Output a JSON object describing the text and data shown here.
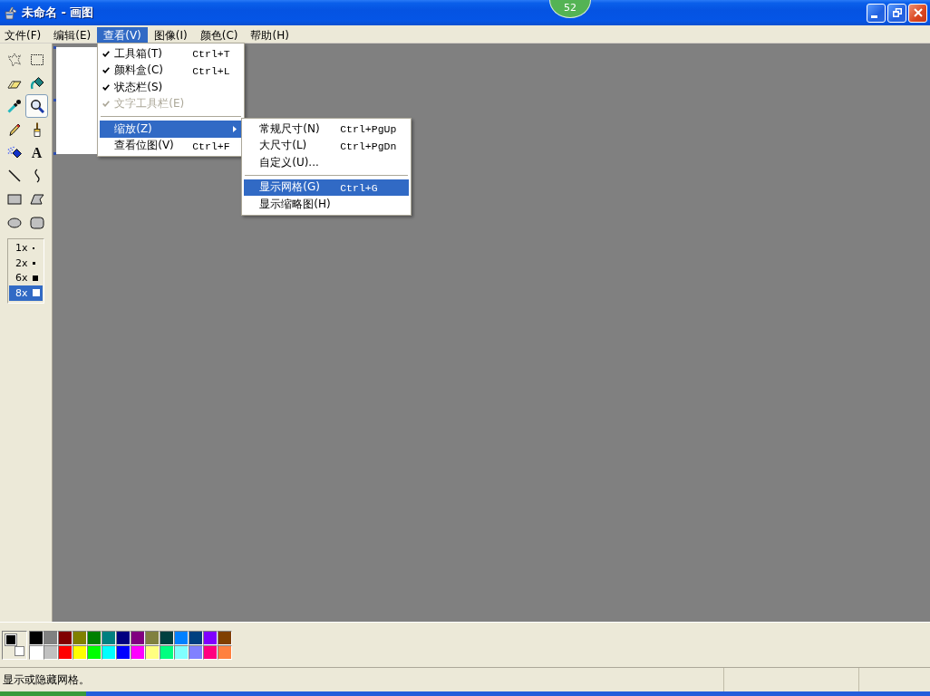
{
  "window": {
    "title": "未命名 - 画图"
  },
  "badge": {
    "text": "52"
  },
  "menu_bar": [
    {
      "label": "文件(F)",
      "selected": false
    },
    {
      "label": "编辑(E)",
      "selected": false
    },
    {
      "label": "查看(V)",
      "selected": true,
      "menu": {
        "groups": [
          [
            {
              "label": "工具箱(T)",
              "shortcut": "Ctrl+T",
              "checked": true,
              "disabled": false,
              "selected": false
            },
            {
              "label": "颜料盒(C)",
              "shortcut": "Ctrl+L",
              "checked": true,
              "disabled": false,
              "selected": false
            },
            {
              "label": "状态栏(S)",
              "checked": true,
              "disabled": false,
              "selected": false
            },
            {
              "label": "文字工具栏(E)",
              "checked": true,
              "disabled": true,
              "selected": false
            }
          ],
          [
            {
              "label": "缩放(Z)",
              "checked": false,
              "disabled": false,
              "selected": true,
              "submenu": {
                "groups": [
                  [
                    {
                      "label": "常规尺寸(N)",
                      "shortcut": "Ctrl+PgUp",
                      "selected": false
                    },
                    {
                      "label": "大尺寸(L)",
                      "shortcut": "Ctrl+PgDn",
                      "selected": false
                    },
                    {
                      "label": "自定义(U)...",
                      "selected": false
                    }
                  ],
                  [
                    {
                      "label": "显示网格(G)",
                      "shortcut": "Ctrl+G",
                      "selected": true
                    },
                    {
                      "label": "显示缩略图(H)",
                      "selected": false
                    }
                  ]
                ]
              }
            },
            {
              "label": "查看位图(V)",
              "shortcut": "Ctrl+F",
              "checked": false,
              "disabled": false,
              "selected": false
            }
          ]
        ]
      }
    },
    {
      "label": "图像(I)",
      "selected": false
    },
    {
      "label": "颜色(C)",
      "selected": false
    },
    {
      "label": "帮助(H)",
      "selected": false
    }
  ],
  "toolbox": {
    "tools": [
      {
        "kind": "free-form-select",
        "selected": false
      },
      {
        "kind": "select",
        "selected": false
      },
      {
        "kind": "eraser",
        "selected": false
      },
      {
        "kind": "fill",
        "selected": false
      },
      {
        "kind": "pick-color",
        "selected": false
      },
      {
        "kind": "magnifier",
        "selected": true
      },
      {
        "kind": "pencil",
        "selected": false
      },
      {
        "kind": "brush",
        "selected": false
      },
      {
        "kind": "airbrush",
        "selected": false
      },
      {
        "kind": "text",
        "glyph": "A",
        "selected": false
      },
      {
        "kind": "line",
        "selected": false
      },
      {
        "kind": "curve",
        "selected": false
      },
      {
        "kind": "rectangle",
        "selected": false
      },
      {
        "kind": "polygon",
        "selected": false
      },
      {
        "kind": "ellipse",
        "selected": false
      },
      {
        "kind": "rounded-rectangle",
        "selected": false
      }
    ],
    "zoom_options": [
      {
        "label": "1x",
        "selected": false
      },
      {
        "label": "2x",
        "selected": false
      },
      {
        "label": "6x",
        "selected": false
      },
      {
        "label": "8x",
        "selected": true
      }
    ]
  },
  "palette": {
    "current_colors": [
      {
        "kind": "foreground",
        "color": "#000000"
      },
      {
        "kind": "background",
        "color": "#ffffff"
      }
    ],
    "colors": [
      {
        "color": "#000000"
      },
      {
        "color": "#808080"
      },
      {
        "color": "#800000"
      },
      {
        "color": "#808000"
      },
      {
        "color": "#008000"
      },
      {
        "color": "#008080"
      },
      {
        "color": "#000080"
      },
      {
        "color": "#800080"
      },
      {
        "color": "#808040"
      },
      {
        "color": "#004040"
      },
      {
        "color": "#0080ff"
      },
      {
        "color": "#004080"
      },
      {
        "color": "#8000ff"
      },
      {
        "color": "#804000"
      },
      {
        "color": "#ffffff"
      },
      {
        "color": "#c0c0c0"
      },
      {
        "color": "#ff0000"
      },
      {
        "color": "#ffff00"
      },
      {
        "color": "#00ff00"
      },
      {
        "color": "#00ffff"
      },
      {
        "color": "#0000ff"
      },
      {
        "color": "#ff00ff"
      },
      {
        "color": "#ffff80"
      },
      {
        "color": "#00ff80"
      },
      {
        "color": "#80ffff"
      },
      {
        "color": "#8080ff"
      },
      {
        "color": "#ff0080"
      },
      {
        "color": "#ff8040"
      }
    ]
  },
  "status_bar": {
    "text": "显示或隐藏网格。"
  }
}
